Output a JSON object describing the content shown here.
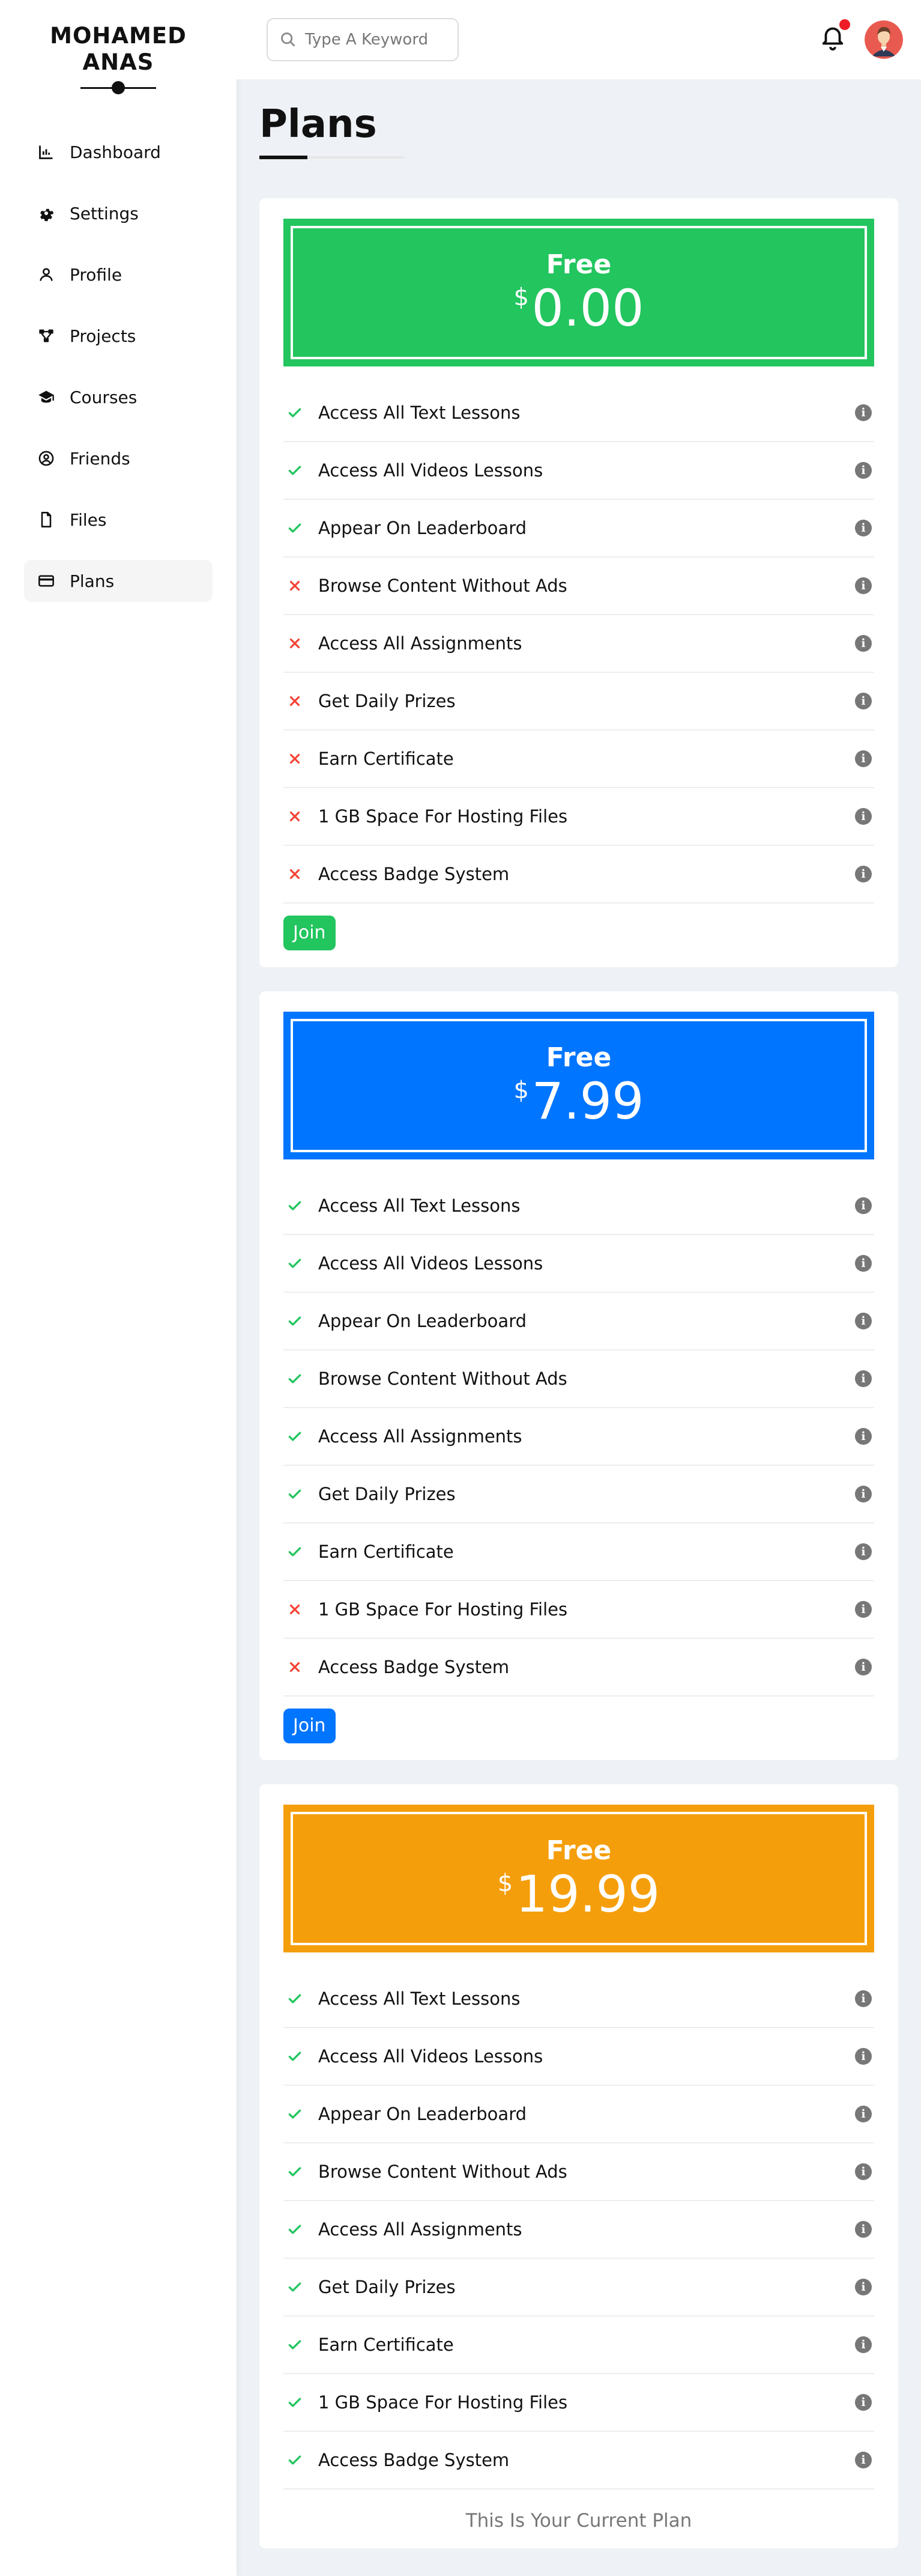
{
  "sidebar": {
    "brand_line1": "MOHAMED",
    "brand_line2": "ANAS",
    "items": [
      {
        "label": "Dashboard",
        "icon": "chart-icon"
      },
      {
        "label": "Settings",
        "icon": "gear-icon"
      },
      {
        "label": "Profile",
        "icon": "user-icon"
      },
      {
        "label": "Projects",
        "icon": "diagram-icon"
      },
      {
        "label": "Courses",
        "icon": "graduation-cap-icon"
      },
      {
        "label": "Friends",
        "icon": "user-circle-icon"
      },
      {
        "label": "Files",
        "icon": "file-icon"
      },
      {
        "label": "Plans",
        "icon": "credit-card-icon"
      }
    ],
    "active_item": "Plans"
  },
  "header": {
    "search_placeholder": "Type A Keyword",
    "has_notification": true
  },
  "page": {
    "title": "Plans"
  },
  "plans": [
    {
      "name": "Free",
      "currency": "$",
      "price": "0.00",
      "color": "#22c55e",
      "features": [
        {
          "label": "Access All Text Lessons",
          "included": true
        },
        {
          "label": "Access All Videos Lessons",
          "included": true
        },
        {
          "label": "Appear On Leaderboard",
          "included": true
        },
        {
          "label": "Browse Content Without Ads",
          "included": false
        },
        {
          "label": "Access All Assignments",
          "included": false
        },
        {
          "label": "Get Daily Prizes",
          "included": false
        },
        {
          "label": "Earn Certificate",
          "included": false
        },
        {
          "label": "1 GB Space For Hosting Files",
          "included": false
        },
        {
          "label": "Access Badge System",
          "included": false
        }
      ],
      "action_label": "Join"
    },
    {
      "name": "Free",
      "currency": "$",
      "price": "7.99",
      "color": "#0075ff",
      "features": [
        {
          "label": "Access All Text Lessons",
          "included": true
        },
        {
          "label": "Access All Videos Lessons",
          "included": true
        },
        {
          "label": "Appear On Leaderboard",
          "included": true
        },
        {
          "label": "Browse Content Without Ads",
          "included": true
        },
        {
          "label": "Access All Assignments",
          "included": true
        },
        {
          "label": "Get Daily Prizes",
          "included": true
        },
        {
          "label": "Earn Certificate",
          "included": true
        },
        {
          "label": "1 GB Space For Hosting Files",
          "included": false
        },
        {
          "label": "Access Badge System",
          "included": false
        }
      ],
      "action_label": "Join"
    },
    {
      "name": "Free",
      "currency": "$",
      "price": "19.99",
      "color": "#f59e0b",
      "features": [
        {
          "label": "Access All Text Lessons",
          "included": true
        },
        {
          "label": "Access All Videos Lessons",
          "included": true
        },
        {
          "label": "Appear On Leaderboard",
          "included": true
        },
        {
          "label": "Browse Content Without Ads",
          "included": true
        },
        {
          "label": "Access All Assignments",
          "included": true
        },
        {
          "label": "Get Daily Prizes",
          "included": true
        },
        {
          "label": "Earn Certificate",
          "included": true
        },
        {
          "label": "1 GB Space For Hosting Files",
          "included": true
        },
        {
          "label": "Access Badge System",
          "included": true
        }
      ],
      "current_label": "This Is Your Current Plan"
    }
  ],
  "colors": {
    "check": "#22c55e",
    "cross": "#f44336",
    "info": "#777777",
    "page_bg": "#eef1f5"
  }
}
